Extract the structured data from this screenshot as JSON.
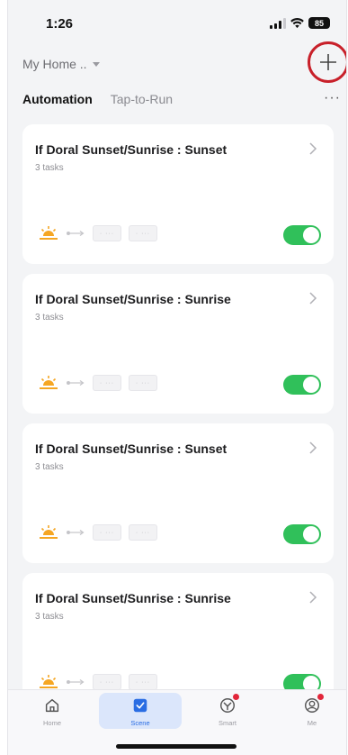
{
  "status_bar": {
    "time": "1:26",
    "battery": "85"
  },
  "header": {
    "home_label": "My Home ..",
    "add_icon": "plus-icon"
  },
  "tabs": [
    {
      "label": "Automation",
      "active": true
    },
    {
      "label": "Tap-to-Run",
      "active": false
    }
  ],
  "more_label": "···",
  "automations": [
    {
      "title": "If Doral Sunset/Sunrise : Sunset",
      "subtitle": "3 tasks",
      "enabled": true
    },
    {
      "title": "If Doral Sunset/Sunrise : Sunrise",
      "subtitle": "3 tasks",
      "enabled": true
    },
    {
      "title": "If Doral Sunset/Sunrise : Sunset",
      "subtitle": "3 tasks",
      "enabled": true
    },
    {
      "title": "If Doral Sunset/Sunrise : Sunrise",
      "subtitle": "3 tasks",
      "enabled": true
    }
  ],
  "task_chip_text": "· ···",
  "tabbar": [
    {
      "label": "Home",
      "icon": "home-icon",
      "active": false,
      "badge": false
    },
    {
      "label": "Scene",
      "icon": "scene-icon",
      "active": true,
      "badge": false
    },
    {
      "label": "Smart",
      "icon": "smart-icon",
      "active": false,
      "badge": true
    },
    {
      "label": "Me",
      "icon": "profile-icon",
      "active": false,
      "badge": true
    }
  ],
  "colors": {
    "accent": "#2a6de3",
    "toggle_on": "#30c05a",
    "highlight_circle": "#c8202a",
    "sun": "#f5a623"
  }
}
